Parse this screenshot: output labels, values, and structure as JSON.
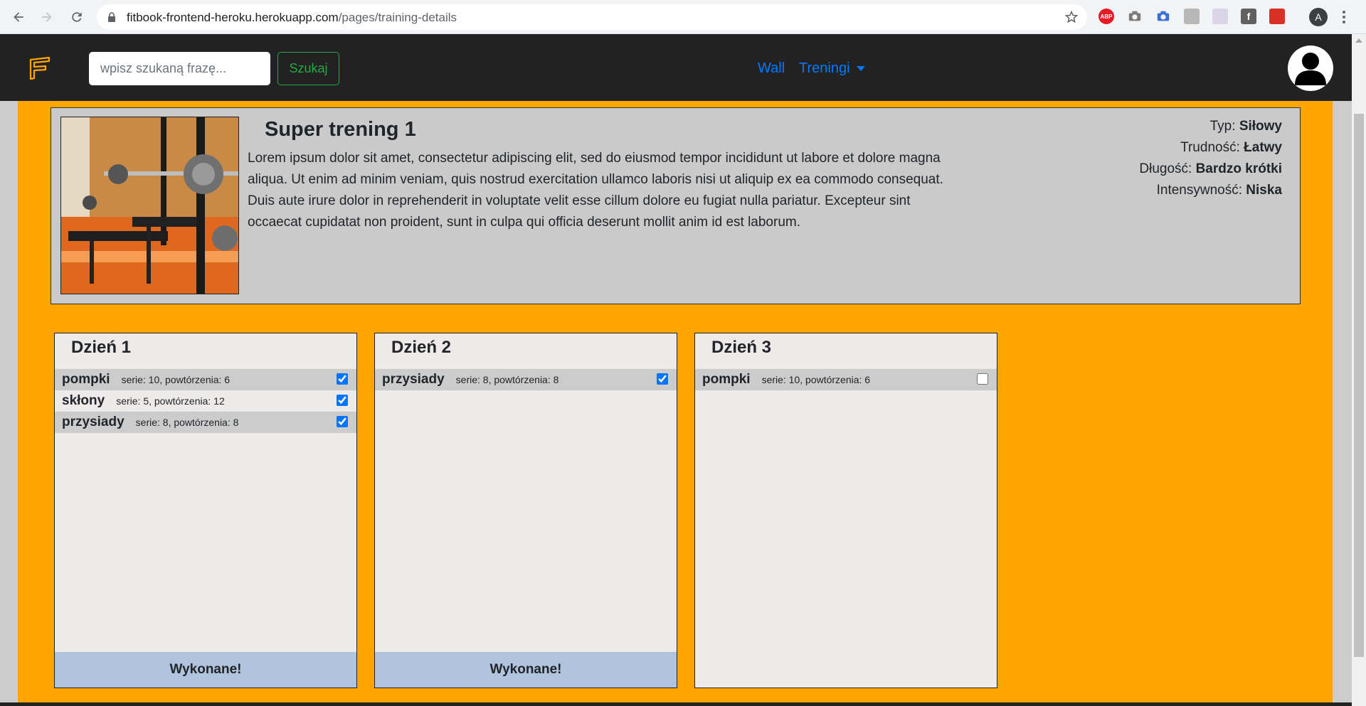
{
  "browser": {
    "url_host": "fitbook-frontend-heroku.herokuapp.com",
    "url_path": "/pages/training-details",
    "profile_initial": "A",
    "extensions": [
      "adblock-icon",
      "camera-icon",
      "camera-blue-icon",
      "clipboard-icon",
      "screenshot-icon",
      "facebook-icon",
      "mail-icon"
    ]
  },
  "navbar": {
    "search_placeholder": "wpisz szukaną frazę...",
    "search_button": "Szukaj",
    "links": {
      "wall": "Wall",
      "trainings": "Treningi"
    },
    "accent_color": "#ffa500"
  },
  "training": {
    "title": "Super trening 1",
    "description": "Lorem ipsum dolor sit amet, consectetur adipiscing elit, sed do eiusmod tempor incididunt ut labore et dolore magna aliqua. Ut enim ad minim veniam, quis nostrud exercitation ullamco laboris nisi ut aliquip ex ea commodo consequat. Duis aute irure dolor in reprehenderit in voluptate velit esse cillum dolore eu fugiat nulla pariatur. Excepteur sint occaecat cupidatat non proident, sunt in culpa qui officia deserunt mollit anim id est laborum.",
    "meta": {
      "type_label": "Typ:",
      "type_value": "Siłowy",
      "difficulty_label": "Trudność:",
      "difficulty_value": "Łatwy",
      "length_label": "Długość:",
      "length_value": "Bardzo krótki",
      "intensity_label": "Intensywność:",
      "intensity_value": "Niska"
    }
  },
  "days": [
    {
      "title": "Dzień 1",
      "exercises": [
        {
          "name": "pompki",
          "info": "serie: 10, powtórzenia: 6",
          "checked": true
        },
        {
          "name": "skłony",
          "info": "serie: 5, powtórzenia: 12",
          "checked": true
        },
        {
          "name": "przysiady",
          "info": "serie: 8, powtórzenia: 8",
          "checked": true
        }
      ],
      "done_button": "Wykonane!"
    },
    {
      "title": "Dzień 2",
      "exercises": [
        {
          "name": "przysiady",
          "info": "serie: 8, powtórzenia: 8",
          "checked": true
        }
      ],
      "done_button": "Wykonane!"
    },
    {
      "title": "Dzień 3",
      "exercises": [
        {
          "name": "pompki",
          "info": "serie: 10, powtórzenia: 6",
          "checked": false
        }
      ]
    }
  ]
}
